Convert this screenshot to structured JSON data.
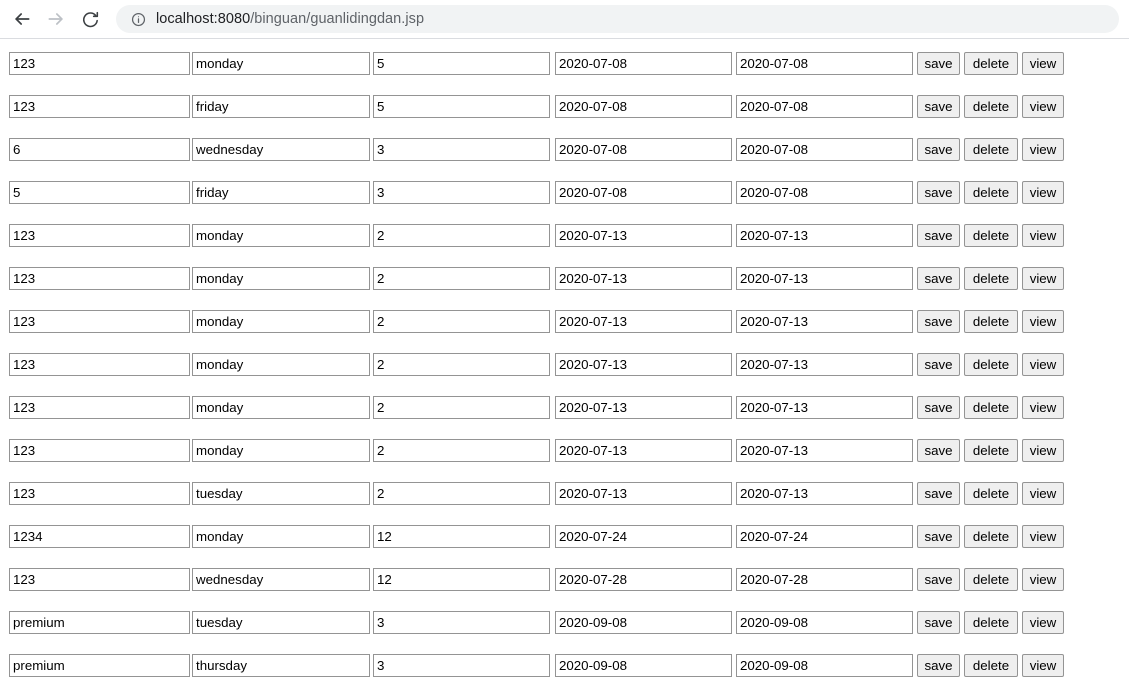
{
  "browser": {
    "back_label": "back-arrow",
    "forward_label": "forward-arrow",
    "reload_label": "reload",
    "site_info_label": "site-information",
    "url_host": "localhost:8080",
    "url_path": "/binguan/guanlidingdan.jsp",
    "url_full": "localhost:8080/binguan/guanlidingdan.jsp"
  },
  "table": {
    "buttons": {
      "save": "save",
      "delete": "delete",
      "view": "view"
    },
    "rows": [
      {
        "c1": "123",
        "c2": "monday",
        "c3": "5",
        "c4": "2020-07-08",
        "c5": "2020-07-08"
      },
      {
        "c1": "123",
        "c2": "friday",
        "c3": "5",
        "c4": "2020-07-08",
        "c5": "2020-07-08"
      },
      {
        "c1": "6",
        "c2": "wednesday",
        "c3": "3",
        "c4": "2020-07-08",
        "c5": "2020-07-08"
      },
      {
        "c1": "5",
        "c2": "friday",
        "c3": "3",
        "c4": "2020-07-08",
        "c5": "2020-07-08"
      },
      {
        "c1": "123",
        "c2": "monday",
        "c3": "2",
        "c4": "2020-07-13",
        "c5": "2020-07-13"
      },
      {
        "c1": "123",
        "c2": "monday",
        "c3": "2",
        "c4": "2020-07-13",
        "c5": "2020-07-13"
      },
      {
        "c1": "123",
        "c2": "monday",
        "c3": "2",
        "c4": "2020-07-13",
        "c5": "2020-07-13"
      },
      {
        "c1": "123",
        "c2": "monday",
        "c3": "2",
        "c4": "2020-07-13",
        "c5": "2020-07-13"
      },
      {
        "c1": "123",
        "c2": "monday",
        "c3": "2",
        "c4": "2020-07-13",
        "c5": "2020-07-13"
      },
      {
        "c1": "123",
        "c2": "monday",
        "c3": "2",
        "c4": "2020-07-13",
        "c5": "2020-07-13"
      },
      {
        "c1": "123",
        "c2": "tuesday",
        "c3": "2",
        "c4": "2020-07-13",
        "c5": "2020-07-13"
      },
      {
        "c1": "1234",
        "c2": "monday",
        "c3": "12",
        "c4": "2020-07-24",
        "c5": "2020-07-24"
      },
      {
        "c1": "123",
        "c2": "wednesday",
        "c3": "12",
        "c4": "2020-07-28",
        "c5": "2020-07-28"
      },
      {
        "c1": "premium",
        "c2": "tuesday",
        "c3": "3",
        "c4": "2020-09-08",
        "c5": "2020-09-08"
      },
      {
        "c1": "premium",
        "c2": "thursday",
        "c3": "3",
        "c4": "2020-09-08",
        "c5": "2020-09-08"
      }
    ]
  }
}
